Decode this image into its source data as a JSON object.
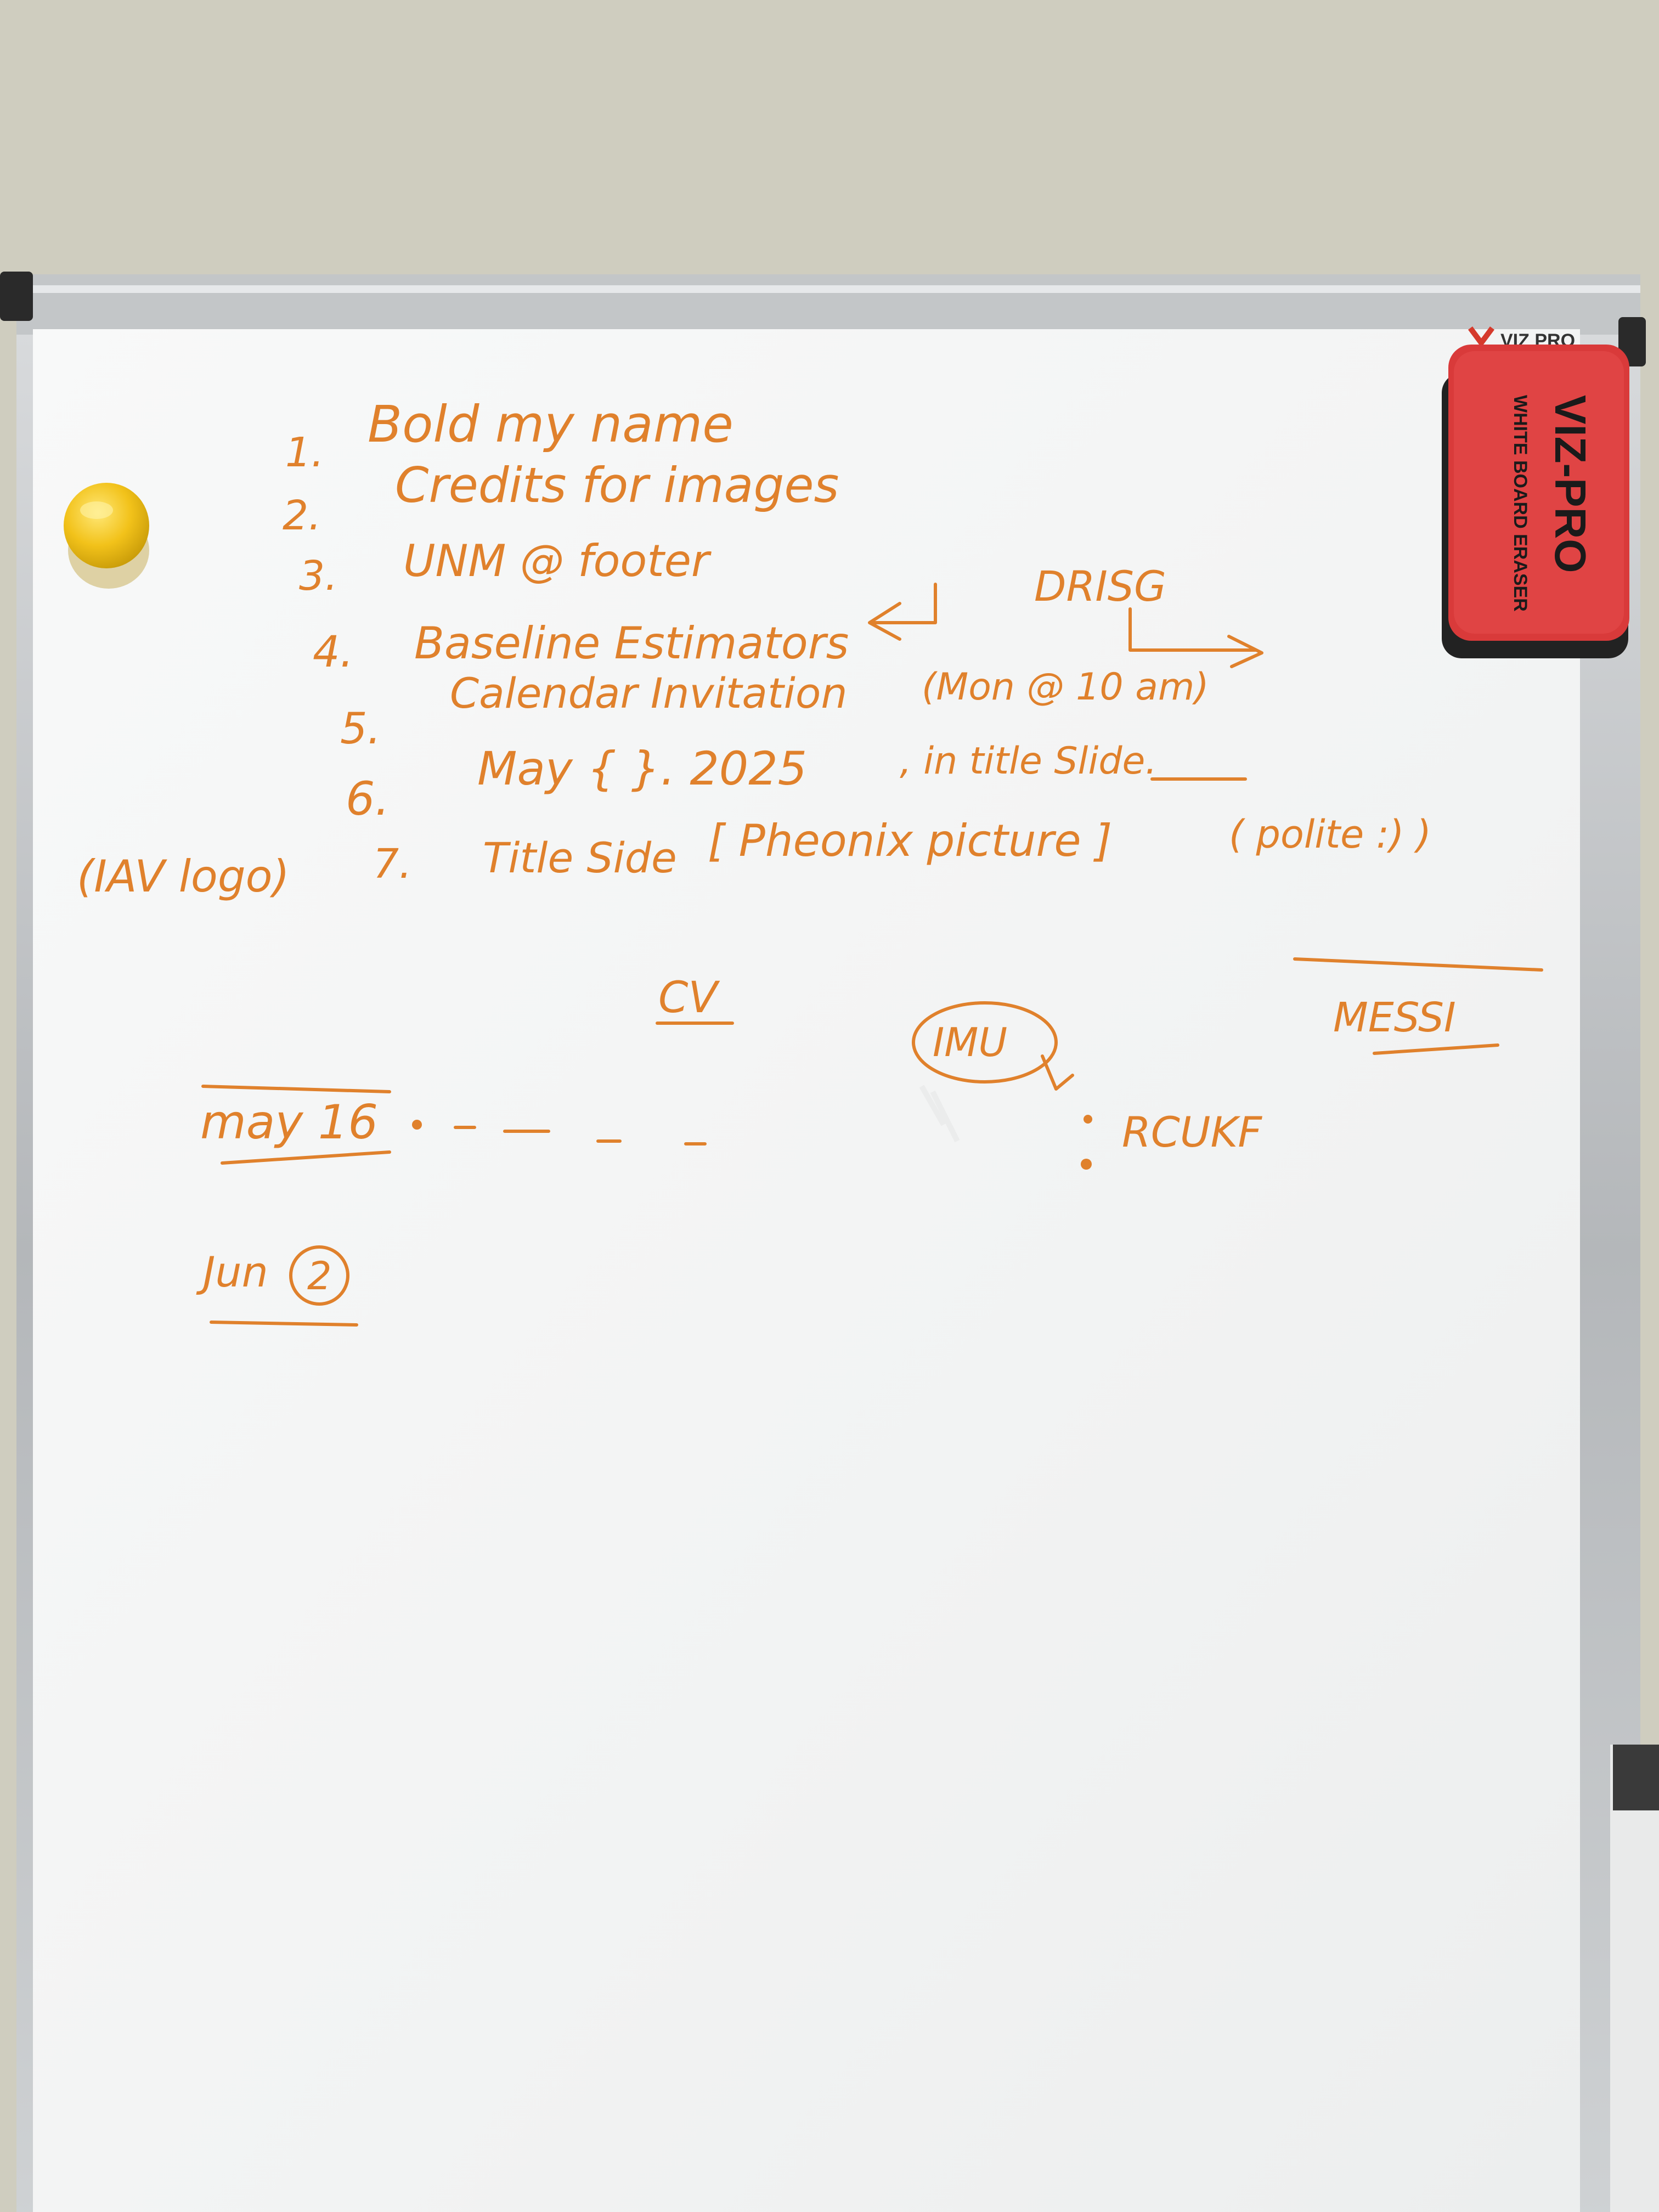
{
  "whiteboard": {
    "brand_label": "VIZ PRO",
    "colors": {
      "wall": "#cfcdbf",
      "board_surface": "#f4f5f5",
      "frame": "#b9bcbf",
      "ink": "#e0812c",
      "magnet": "#f2c21a",
      "eraser": "#d93a3a"
    },
    "list_items": [
      {
        "num": "1.",
        "text": "Bold my name"
      },
      {
        "num": "2.",
        "text": "Credits for images"
      },
      {
        "num": "3.",
        "text": "UNM @ footer"
      },
      {
        "num": "4.",
        "text": "Baseline Estimators"
      },
      {
        "num": "5.",
        "text": "Calendar Invitation"
      },
      {
        "num": "6.",
        "text": "May {  }. 2025"
      },
      {
        "num": "7.",
        "text": "Title Side"
      }
    ],
    "notes": {
      "drisg": "DRISG",
      "calendar_time": "(Mon @ 10 am)",
      "title_slide": ", in title Slide.",
      "phoenix": "[ Pheonix picture ]",
      "polite": "( polite :) )",
      "iav_logo": "(IAV logo)",
      "cv": "CV",
      "imu": "IMU",
      "messi": "MESSI",
      "may16": "may 16",
      "rcukf": "RCUKF",
      "jun": "Jun",
      "jun_day": "2"
    }
  },
  "eraser": {
    "title": "VIZ-PRO",
    "subtitle": "WHITE BOARD ERASER"
  },
  "magnet": {
    "icon": "magnet-icon"
  }
}
